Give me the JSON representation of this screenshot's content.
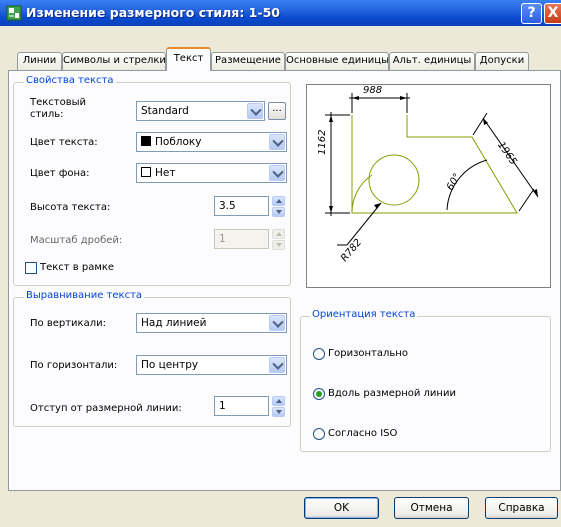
{
  "window": {
    "title": "Изменение размерного стиля: 1-50",
    "help_label": "?",
    "close_label": "X"
  },
  "tabs": [
    {
      "label": "Линии"
    },
    {
      "label": "Символы и стрелки"
    },
    {
      "label": "Текст"
    },
    {
      "label": "Размещение"
    },
    {
      "label": "Основные единицы"
    },
    {
      "label": "Альт. единицы"
    },
    {
      "label": "Допуски"
    }
  ],
  "text_props": {
    "legend": "Свойства текста",
    "style_label_1": "Текстовый",
    "style_label_2": "стиль:",
    "style_value": "Standard",
    "ellipsis_label": "...",
    "color_label": "Цвет текста:",
    "color_value": "Поблоку",
    "fill_label": "Цвет фона:",
    "fill_value": "Нет",
    "height_label": "Высота текста:",
    "height_value": "3.5",
    "fraction_label": "Масштаб дробей:",
    "fraction_value": "1",
    "frame_label": "Текст в рамке"
  },
  "alignment": {
    "legend": "Выравнивание текста",
    "vertical_label": "По вертикали:",
    "vertical_value": "Над линией",
    "horizontal_label": "По горизонтали:",
    "horizontal_value": "По центру",
    "offset_label": "Отступ от размерной линии:",
    "offset_value": "1"
  },
  "orientation": {
    "legend": "Ориентация текста",
    "options": [
      {
        "label": "Горизонтально",
        "checked": false
      },
      {
        "label": "Вдоль размерной линии",
        "checked": true
      },
      {
        "label": "Согласно ISO",
        "checked": false
      }
    ]
  },
  "preview": {
    "dim_top": "988",
    "dim_left": "1162",
    "dim_right": "1965",
    "dim_angle": "60°",
    "dim_radius": "R782"
  },
  "buttons": {
    "ok": "OK",
    "cancel": "Отмена",
    "help": "Справка"
  },
  "colors": {
    "title_bar": "#0a49d0",
    "legend_text": "#0046d5",
    "active_tab_accent": "#e68b2c",
    "preview_geometry": "#80a000"
  }
}
